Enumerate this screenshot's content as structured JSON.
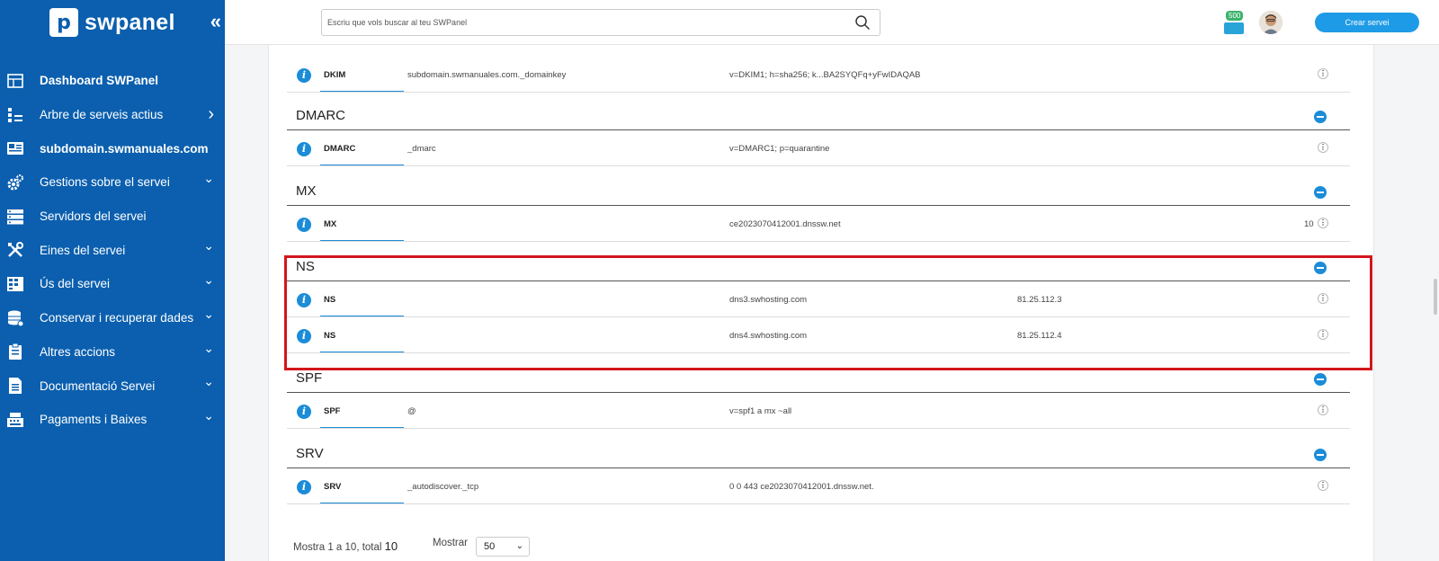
{
  "sidebar": {
    "logo_letter": "p",
    "logo_text": "swpanel",
    "collapse_icon": "«",
    "items": [
      {
        "label": "Dashboard SWPanel",
        "icon": "dashboard-icon",
        "bold": true,
        "arrow": ""
      },
      {
        "label": "Arbre de serveis actius",
        "icon": "tree-icon",
        "bold": false,
        "arrow": "›"
      },
      {
        "label": "subdomain.swmanuales.com",
        "icon": "domain-icon",
        "bold": true,
        "arrow": ""
      },
      {
        "label": "Gestions sobre el servei",
        "icon": "gears-icon",
        "bold": false,
        "arrow": "⌄"
      },
      {
        "label": "Servidors del servei",
        "icon": "server-icon",
        "bold": false,
        "arrow": ""
      },
      {
        "label": "Eines del servei",
        "icon": "tools-icon",
        "bold": false,
        "arrow": "⌄"
      },
      {
        "label": "Ús del servei",
        "icon": "usage-icon",
        "bold": false,
        "arrow": "⌄"
      },
      {
        "label": "Conservar i recuperar dades",
        "icon": "database-icon",
        "bold": false,
        "arrow": "⌄"
      },
      {
        "label": "Altres accions",
        "icon": "clipboard-icon",
        "bold": false,
        "arrow": "⌄"
      },
      {
        "label": "Documentació Servei",
        "icon": "document-icon",
        "bold": false,
        "arrow": "⌄"
      },
      {
        "label": "Pagaments i Baixes",
        "icon": "cash-register-icon",
        "bold": false,
        "arrow": "⌄"
      }
    ]
  },
  "topbar": {
    "search_placeholder": "Escriu que vols buscar al teu SWPanel",
    "credits_badge": "500",
    "create_button": "Crear servei"
  },
  "records": {
    "dkim": {
      "type": "DKIM",
      "name": "subdomain.swmanuales.com._domainkey",
      "value": "v=DKIM1; h=sha256; k...BA2SYQFq+yFwIDAQAB"
    },
    "sections": [
      {
        "title": "DMARC",
        "rows": [
          {
            "type": "DMARC",
            "name": "_dmarc",
            "value": "v=DMARC1; p=quarantine",
            "ip": "",
            "priority": ""
          }
        ]
      },
      {
        "title": "MX",
        "rows": [
          {
            "type": "MX",
            "name": "",
            "value": "ce2023070412001.dnssw.net",
            "ip": "",
            "priority": "10"
          }
        ]
      },
      {
        "title": "NS",
        "rows": [
          {
            "type": "NS",
            "name": "",
            "value": "dns3.swhosting.com",
            "ip": "81.25.112.3",
            "priority": ""
          },
          {
            "type": "NS",
            "name": "",
            "value": "dns4.swhosting.com",
            "ip": "81.25.112.4",
            "priority": ""
          }
        ]
      },
      {
        "title": "SPF",
        "rows": [
          {
            "type": "SPF",
            "name": "@",
            "value": "v=spf1 a mx ~all",
            "ip": "",
            "priority": ""
          }
        ]
      },
      {
        "title": "SRV",
        "rows": [
          {
            "type": "SRV",
            "name": "_autodiscover._tcp",
            "value": "0 0 443 ce2023070412001.dnssw.net.",
            "ip": "",
            "priority": ""
          }
        ]
      }
    ]
  },
  "footer": {
    "showing_prefix": "Mostra 1 a 10, total ",
    "total": "10",
    "show_label": "Mostrar",
    "page_size": "50"
  },
  "colors": {
    "sidebar": "#0b5fae",
    "accent": "#1b8cd8",
    "highlight": "#d2161c"
  }
}
